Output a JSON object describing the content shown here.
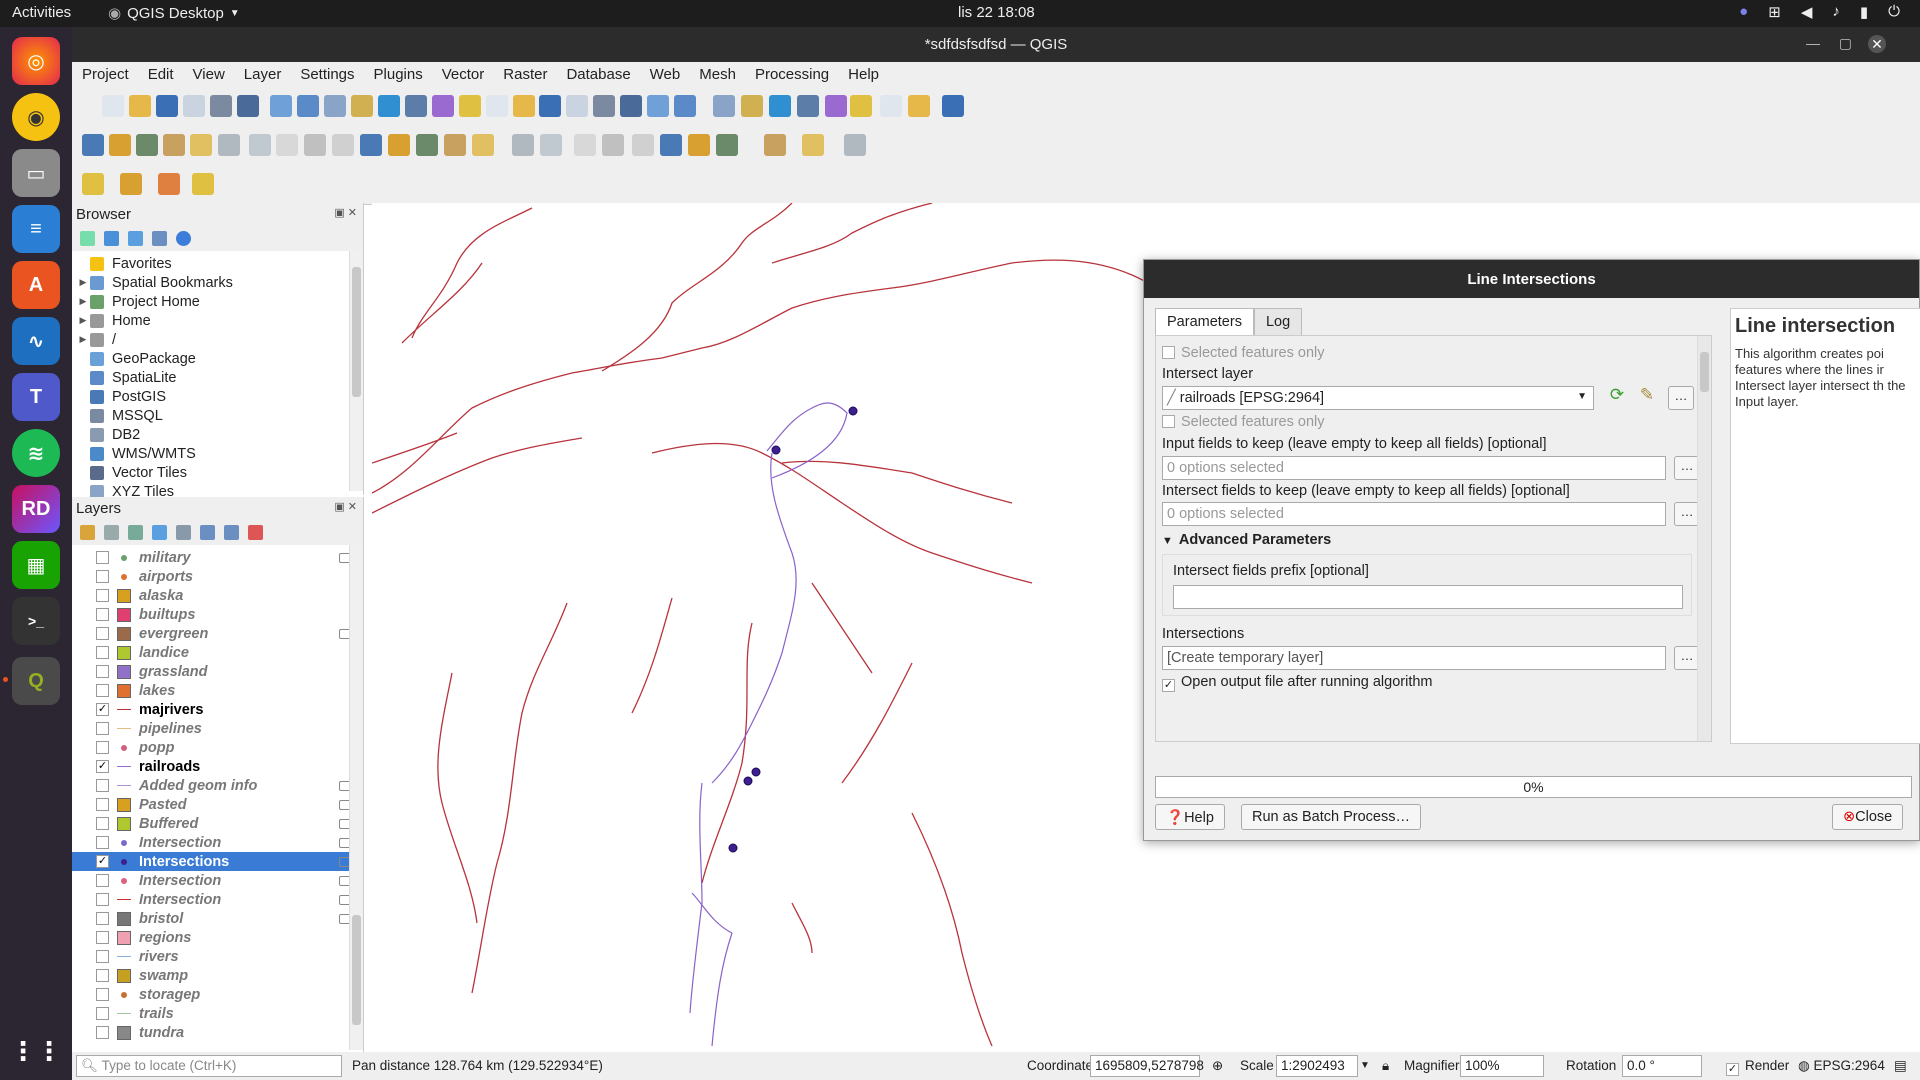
{
  "system": {
    "activities": "Activities",
    "app_name": "QGIS Desktop",
    "clock": "lis 22  18:08"
  },
  "window": {
    "title": "*sdfdsfsdfsd — QGIS"
  },
  "menubar": [
    "Project",
    "Edit",
    "View",
    "Layer",
    "Settings",
    "Plugins",
    "Vector",
    "Raster",
    "Database",
    "Web",
    "Mesh",
    "Processing",
    "Help"
  ],
  "browser": {
    "title": "Browser",
    "items": [
      "Favorites",
      "Spatial Bookmarks",
      "Project Home",
      "Home",
      "/",
      "GeoPackage",
      "SpatiaLite",
      "PostGIS",
      "MSSQL",
      "DB2",
      "WMS/WMTS",
      "Vector Tiles",
      "XYZ Tiles"
    ]
  },
  "layers": {
    "title": "Layers",
    "items": [
      {
        "name": "military",
        "checked": false
      },
      {
        "name": "airports",
        "checked": false
      },
      {
        "name": "alaska",
        "checked": false
      },
      {
        "name": "builtups",
        "checked": false
      },
      {
        "name": "evergreen",
        "checked": false
      },
      {
        "name": "landice",
        "checked": false
      },
      {
        "name": "grassland",
        "checked": false
      },
      {
        "name": "lakes",
        "checked": false
      },
      {
        "name": "majrivers",
        "checked": true
      },
      {
        "name": "pipelines",
        "checked": false
      },
      {
        "name": "popp",
        "checked": false
      },
      {
        "name": "railroads",
        "checked": true
      },
      {
        "name": "Added geom info",
        "checked": false
      },
      {
        "name": "Pasted",
        "checked": false
      },
      {
        "name": "Buffered",
        "checked": false
      },
      {
        "name": "Intersection",
        "checked": false
      },
      {
        "name": "Intersections",
        "checked": true
      },
      {
        "name": "Intersection",
        "checked": false
      },
      {
        "name": "Intersection",
        "checked": false
      },
      {
        "name": "bristol",
        "checked": false
      },
      {
        "name": "regions",
        "checked": false
      },
      {
        "name": "rivers",
        "checked": false
      },
      {
        "name": "swamp",
        "checked": false
      },
      {
        "name": "storagep",
        "checked": false
      },
      {
        "name": "trails",
        "checked": false
      },
      {
        "name": "tundra",
        "checked": false
      }
    ]
  },
  "dialog": {
    "title": "Line Intersections",
    "tabs": [
      "Parameters",
      "Log"
    ],
    "selected_features_only": "Selected features only",
    "intersect_layer_label": "Intersect layer",
    "intersect_layer_value": "railroads [EPSG:2964]",
    "selected_features_only_2": "Selected features only",
    "input_fields_label": "Input fields to keep (leave empty to keep all fields) [optional]",
    "input_fields_placeholder": "0 options selected",
    "intersect_fields_label": "Intersect fields to keep (leave empty to keep all fields) [optional]",
    "intersect_fields_placeholder": "0 options selected",
    "advanced_label": "Advanced Parameters",
    "prefix_label": "Intersect fields prefix [optional]",
    "prefix_value": "",
    "intersections_label": "Intersections",
    "intersections_placeholder": "[Create temporary layer]",
    "open_output_label": "Open output file after running algorithm",
    "progress": "0%",
    "help_button": "Help",
    "batch_button": "Run as Batch Process…",
    "close_button": "Close",
    "help_title": "Line intersection",
    "help_text": "This algorithm creates poi features where the lines ir Intersect layer intersect th the Input layer.",
    "ellipsis": "…"
  },
  "statusbar": {
    "locate_placeholder": "Type to locate (Ctrl+K)",
    "message": "Pan distance 128.764 km (129.522934°E)",
    "coordinate_label": "Coordinate",
    "coordinate_value": "1695809,5278798",
    "scale_label": "Scale",
    "scale_value": "1:2902493",
    "magnifier_label": "Magnifier",
    "magnifier_value": "100%",
    "rotation_label": "Rotation",
    "rotation_value": "0.0 °",
    "render_label": "Render",
    "crs": "EPSG:2964"
  },
  "colors": {
    "railroads": "#b8333c",
    "majrivers": "#8a62c9",
    "intersections": "#3d1f8f",
    "selection": "#3a7bd5"
  }
}
